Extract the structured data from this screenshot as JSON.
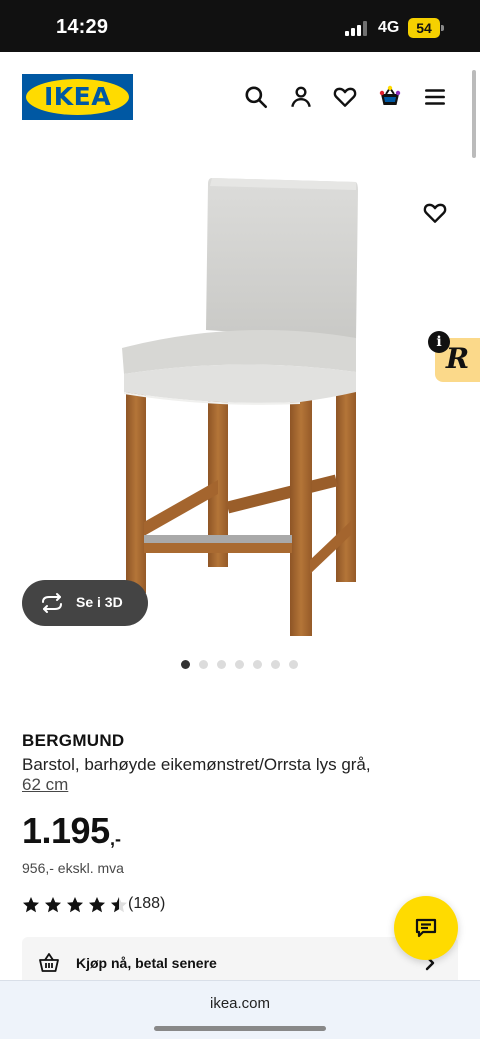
{
  "status_bar": {
    "time": "14:29",
    "network": "4G",
    "battery": "54"
  },
  "header": {
    "logo_text": "IKEA"
  },
  "gallery": {
    "view_3d_label": "Se i 3D",
    "total_images": 7,
    "active_index": 0,
    "badge_letter": "R",
    "info_glyph": "i"
  },
  "product": {
    "name": "BERGMUND",
    "description": "Barstol, barhøyde eikemønstret/Orrsta lys grå,",
    "size": "62 cm",
    "price": "1.195",
    "price_suffix": ",-",
    "price_ex_vat": "956,- ekskl. mva",
    "rating": 4.5,
    "review_count": "(188)"
  },
  "payment": {
    "label": "Kjøp nå, betal senere"
  },
  "browser": {
    "url": "ikea.com"
  },
  "colors": {
    "brand_blue": "#0058a3",
    "brand_yellow": "#ffdb00"
  }
}
